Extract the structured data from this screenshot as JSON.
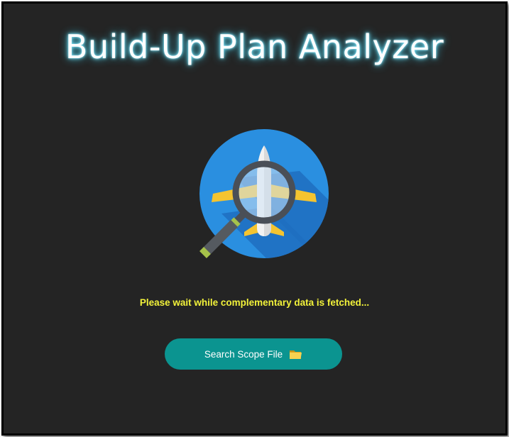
{
  "app": {
    "title": "Build-Up Plan Analyzer"
  },
  "logo": {
    "icon": "airplane-magnifier-icon",
    "colors": {
      "circle": "#2a8fe0",
      "shadow": "#1f6fbf",
      "wings": "#f4c430",
      "lens_ring": "#4a4f57",
      "handle_band": "#a6c24a"
    }
  },
  "status": {
    "message": "Please wait while complementary data is fetched...",
    "color": "#f2f23a"
  },
  "search_button": {
    "label": "Search Scope File",
    "icon": "folder-icon",
    "color": "#0b9490"
  }
}
